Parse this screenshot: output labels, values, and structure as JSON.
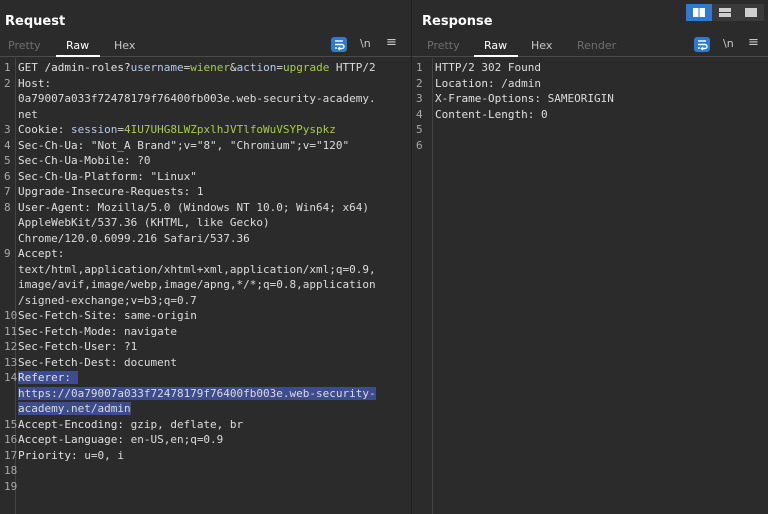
{
  "request": {
    "title": "Request",
    "tabs": [
      "Pretty",
      "Raw",
      "Hex"
    ],
    "active_tab": "Raw",
    "tools": {
      "newline": "\\n",
      "menu": "≡"
    },
    "lines": [
      {
        "n": "1",
        "parts": [
          [
            "",
            "GET "
          ],
          [
            "path",
            "/admin-roles?"
          ],
          [
            "pn",
            "username"
          ],
          [
            "",
            "="
          ],
          [
            "pv",
            "wiener"
          ],
          [
            "",
            "&"
          ],
          [
            "pn",
            "action"
          ],
          [
            "",
            "="
          ],
          [
            "pv",
            "upgrade"
          ],
          [
            "",
            " HTTP/2"
          ]
        ]
      },
      {
        "n": "2",
        "parts": [
          [
            "hn",
            "Host"
          ],
          [
            "",
            ":"
          ]
        ]
      },
      {
        "n": "",
        "parts": [
          [
            "",
            "0a79007a033f72478179f76400fb003e.web-security-academy."
          ]
        ]
      },
      {
        "n": "",
        "parts": [
          [
            "",
            "net"
          ]
        ]
      },
      {
        "n": "3",
        "parts": [
          [
            "hn",
            "Cookie"
          ],
          [
            "",
            ": "
          ],
          [
            "pn",
            "session"
          ],
          [
            "",
            "="
          ],
          [
            "cv",
            "4IU7UHG8LWZpxlhJVTlfoWuVSYPyspkz"
          ]
        ]
      },
      {
        "n": "4",
        "parts": [
          [
            "hn",
            "Sec-Ch-Ua"
          ],
          [
            "",
            ": \"Not_A Brand\";v=\"8\", \"Chromium\";v=\"120\""
          ]
        ]
      },
      {
        "n": "5",
        "parts": [
          [
            "hn",
            "Sec-Ch-Ua-Mobile"
          ],
          [
            "",
            ": ?0"
          ]
        ]
      },
      {
        "n": "6",
        "parts": [
          [
            "hn",
            "Sec-Ch-Ua-Platform"
          ],
          [
            "",
            ": \"Linux\""
          ]
        ]
      },
      {
        "n": "7",
        "parts": [
          [
            "hn",
            "Upgrade-Insecure-Requests"
          ],
          [
            "",
            ": 1"
          ]
        ]
      },
      {
        "n": "8",
        "parts": [
          [
            "hn",
            "User-Agent"
          ],
          [
            "",
            ": Mozilla/5.0 (Windows NT 10.0; Win64; x64)"
          ]
        ]
      },
      {
        "n": "",
        "parts": [
          [
            "",
            "AppleWebKit/537.36 (KHTML, like Gecko)"
          ]
        ]
      },
      {
        "n": "",
        "parts": [
          [
            "",
            "Chrome/120.0.6099.216 Safari/537.36"
          ]
        ]
      },
      {
        "n": "9",
        "parts": [
          [
            "hn",
            "Accept"
          ],
          [
            "",
            ":"
          ]
        ]
      },
      {
        "n": "",
        "parts": [
          [
            "",
            "text/html,application/xhtml+xml,application/xml;q=0.9,"
          ]
        ]
      },
      {
        "n": "",
        "parts": [
          [
            "",
            "image/avif,image/webp,image/apng,*/*;q=0.8,application"
          ]
        ]
      },
      {
        "n": "",
        "parts": [
          [
            "",
            "/signed-exchange;v=b3;q=0.7"
          ]
        ]
      },
      {
        "n": "10",
        "parts": [
          [
            "hn",
            "Sec-Fetch-Site"
          ],
          [
            "",
            ": same-origin"
          ]
        ]
      },
      {
        "n": "11",
        "parts": [
          [
            "hn",
            "Sec-Fetch-Mode"
          ],
          [
            "",
            ": navigate"
          ]
        ]
      },
      {
        "n": "12",
        "parts": [
          [
            "hn",
            "Sec-Fetch-User"
          ],
          [
            "",
            ": ?1"
          ]
        ]
      },
      {
        "n": "13",
        "parts": [
          [
            "hn",
            "Sec-Fetch-Dest"
          ],
          [
            "",
            ": document"
          ]
        ]
      },
      {
        "n": "14",
        "sel": true,
        "parts": [
          [
            "hn",
            "Referer"
          ],
          [
            "",
            ": "
          ]
        ]
      },
      {
        "n": "",
        "sel": true,
        "parts": [
          [
            "",
            "https://0a79007a033f72478179f76400fb003e.web-security-"
          ]
        ]
      },
      {
        "n": "",
        "sel": true,
        "parts": [
          [
            "",
            "academy.net/admin"
          ]
        ]
      },
      {
        "n": "15",
        "parts": [
          [
            "hn",
            "Accept-Encoding"
          ],
          [
            "",
            ": gzip, deflate, br"
          ]
        ]
      },
      {
        "n": "16",
        "parts": [
          [
            "hn",
            "Accept-Language"
          ],
          [
            "",
            ": en-US,en;q=0.9"
          ]
        ]
      },
      {
        "n": "17",
        "parts": [
          [
            "hn",
            "Priority"
          ],
          [
            "",
            ": u=0, i"
          ]
        ]
      },
      {
        "n": "18",
        "parts": []
      },
      {
        "n": "19",
        "parts": []
      }
    ]
  },
  "response": {
    "title": "Response",
    "tabs": [
      "Pretty",
      "Raw",
      "Hex",
      "Render"
    ],
    "active_tab": "Raw",
    "tools": {
      "newline": "\\n",
      "menu": "≡"
    },
    "lines": [
      {
        "n": "1",
        "parts": [
          [
            "",
            "HTTP/2 302 Found"
          ]
        ]
      },
      {
        "n": "2",
        "parts": [
          [
            "hn",
            "Location"
          ],
          [
            "",
            ": /admin"
          ]
        ]
      },
      {
        "n": "3",
        "parts": [
          [
            "hn",
            "X-Frame-Options"
          ],
          [
            "",
            ": SAMEORIGIN"
          ]
        ]
      },
      {
        "n": "4",
        "parts": [
          [
            "hn",
            "Content-Length"
          ],
          [
            "",
            ": 0"
          ]
        ]
      },
      {
        "n": "5",
        "parts": []
      },
      {
        "n": "6",
        "parts": []
      }
    ]
  },
  "layout_buttons": [
    {
      "icon": "split-columns-icon",
      "active": true
    },
    {
      "icon": "split-rows-icon",
      "active": false
    },
    {
      "icon": "single-pane-icon",
      "active": false
    }
  ],
  "colors": {
    "accent": "#2f7ad1",
    "background": "#2b2b2b",
    "param_value": "#a7cc4a",
    "selection": "#3c4c8c"
  }
}
